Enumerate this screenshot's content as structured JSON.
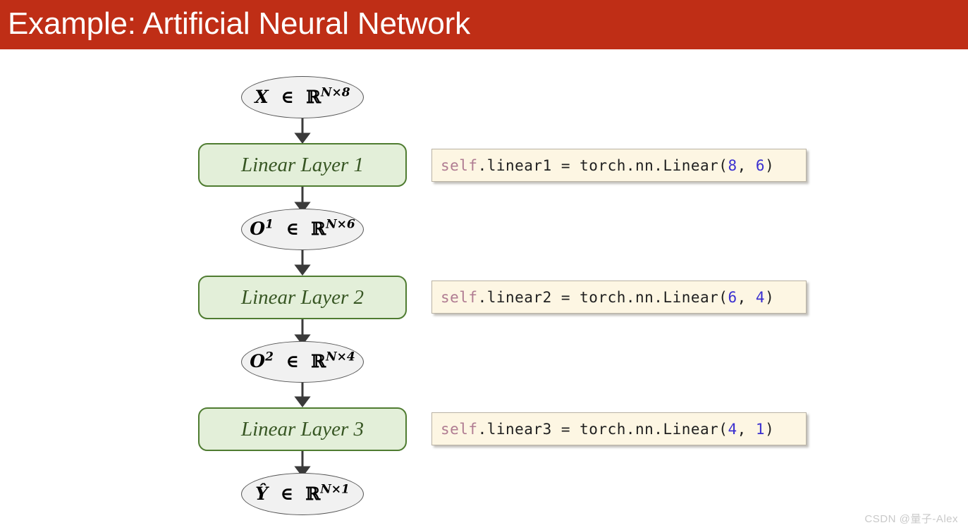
{
  "header": {
    "title": "Example: Artificial Neural Network",
    "background_color": "#bf2e16",
    "text_color": "#ffffff"
  },
  "colors": {
    "ellipse_fill": "#f1f1f1",
    "ellipse_border": "#555555",
    "layer_fill": "#e3efd9",
    "layer_border": "#4f7c31",
    "layer_text": "#375623",
    "code_fill": "#fdf6e3",
    "code_border": "#b9b2a4",
    "code_keyword": "#b07c92",
    "code_number": "#3a2fd0",
    "arrow": "#3a3a3a",
    "watermark": "#c9c9c9"
  },
  "diagram": {
    "type": "flowchart",
    "title": "Artificial Neural Network forward pass",
    "nodes": [
      {
        "id": "input",
        "shape": "ellipse",
        "symbol": "X",
        "superscript": "",
        "relation": "∈",
        "space": "ℝ",
        "dims": "N×8",
        "label": "X ∈ ℝ^{N×8}"
      },
      {
        "id": "layer1",
        "shape": "rounded-rect",
        "label": "Linear Layer 1"
      },
      {
        "id": "out1",
        "shape": "ellipse",
        "symbol": "O",
        "superscript": "1",
        "relation": "∈",
        "space": "ℝ",
        "dims": "N×6",
        "label": "O¹ ∈ ℝ^{N×6}"
      },
      {
        "id": "layer2",
        "shape": "rounded-rect",
        "label": "Linear Layer 2"
      },
      {
        "id": "out2",
        "shape": "ellipse",
        "symbol": "O",
        "superscript": "2",
        "relation": "∈",
        "space": "ℝ",
        "dims": "N×4",
        "label": "O² ∈ ℝ^{N×4}"
      },
      {
        "id": "layer3",
        "shape": "rounded-rect",
        "label": "Linear Layer 3"
      },
      {
        "id": "output",
        "shape": "ellipse",
        "symbol": "Ŷ",
        "superscript": "",
        "relation": "∈",
        "space": "ℝ",
        "dims": "N×1",
        "label": "Ŷ ∈ ℝ^{N×1}"
      }
    ],
    "edges": [
      {
        "from": "input",
        "to": "layer1"
      },
      {
        "from": "layer1",
        "to": "out1"
      },
      {
        "from": "out1",
        "to": "layer2"
      },
      {
        "from": "layer2",
        "to": "out2"
      },
      {
        "from": "out2",
        "to": "layer3"
      },
      {
        "from": "layer3",
        "to": "output"
      }
    ]
  },
  "code_callouts": [
    {
      "id": "code1",
      "for_node": "layer1",
      "text": "self.linear1 = torch.nn.Linear(8, 6)",
      "keyword": "self",
      "rest": ".linear1 = torch.nn.Linear(",
      "arg_in": "8",
      "comma": ", ",
      "arg_out": "6",
      "close": ")"
    },
    {
      "id": "code2",
      "for_node": "layer2",
      "text": "self.linear2 = torch.nn.Linear(6, 4)",
      "keyword": "self",
      "rest": ".linear2 = torch.nn.Linear(",
      "arg_in": "6",
      "comma": ", ",
      "arg_out": "4",
      "close": ")"
    },
    {
      "id": "code3",
      "for_node": "layer3",
      "text": "self.linear3 = torch.nn.Linear(4, 1)",
      "keyword": "self",
      "rest": ".linear3 = torch.nn.Linear(",
      "arg_in": "4",
      "comma": ", ",
      "arg_out": "1",
      "close": ")"
    }
  ],
  "watermark": {
    "text": "CSDN @量子-Alex"
  }
}
